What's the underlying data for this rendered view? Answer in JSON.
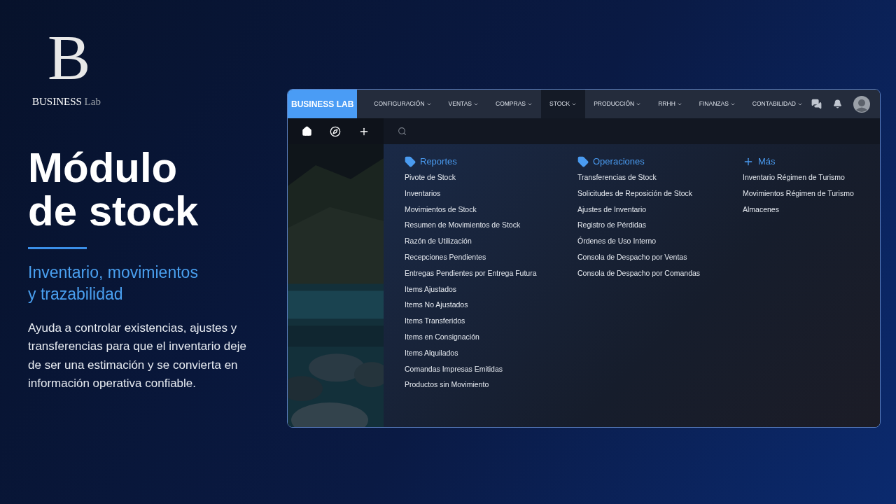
{
  "logo": {
    "mark": "B",
    "name": "BUSINESS",
    "suffix": "Lab"
  },
  "hero": {
    "title_lines": [
      "Módulo",
      "de stock"
    ],
    "subtitle_lines": [
      "Inventario, movimientos",
      "y trazabilidad"
    ],
    "description": "Ayuda a controlar existencias, ajustes y transferencias para que el inventario deje de ser una estimación y se convierta en información operativa confiable."
  },
  "app": {
    "brand": "BUSINESS LAB",
    "nav": [
      {
        "label": "CONFIGURACIÓN",
        "selected": false
      },
      {
        "label": "VENTAS",
        "selected": false
      },
      {
        "label": "COMPRAS",
        "selected": false
      },
      {
        "label": "STOCK",
        "selected": true
      },
      {
        "label": "PRODUCCIÓN",
        "selected": false
      },
      {
        "label": "RRHH",
        "selected": false
      },
      {
        "label": "FINANZAS",
        "selected": false
      },
      {
        "label": "CONTABILIDAD",
        "selected": false
      }
    ],
    "menu": [
      {
        "kind": "tag",
        "title": "Reportes",
        "items": [
          "Pivote de Stock",
          "Inventarios",
          "Movimientos de Stock",
          "Resumen de Movimientos de Stock",
          "Razón de Utilización",
          "Recepciones Pendientes",
          "Entregas Pendientes por Entrega Futura",
          "Items Ajustados",
          "Items No Ajustados",
          "Items Transferidos",
          "Items en Consignación",
          "Items Alquilados",
          "Comandas Impresas Emitidas",
          "Productos sin Movimiento"
        ]
      },
      {
        "kind": "tag",
        "title": "Operaciones",
        "items": [
          "Transferencias de Stock",
          "Solicitudes de Reposición de Stock",
          "Ajustes de Inventario",
          "Registro de Pérdidas",
          "Órdenes de Uso Interno",
          "Consola de Despacho por Ventas",
          "Consola de Despacho por Comandas"
        ]
      },
      {
        "kind": "plus",
        "title": "Más",
        "items": [
          "Inventario Régimen de Turismo",
          "Movimientos Régimen de Turismo",
          "Almacenes"
        ]
      }
    ]
  }
}
